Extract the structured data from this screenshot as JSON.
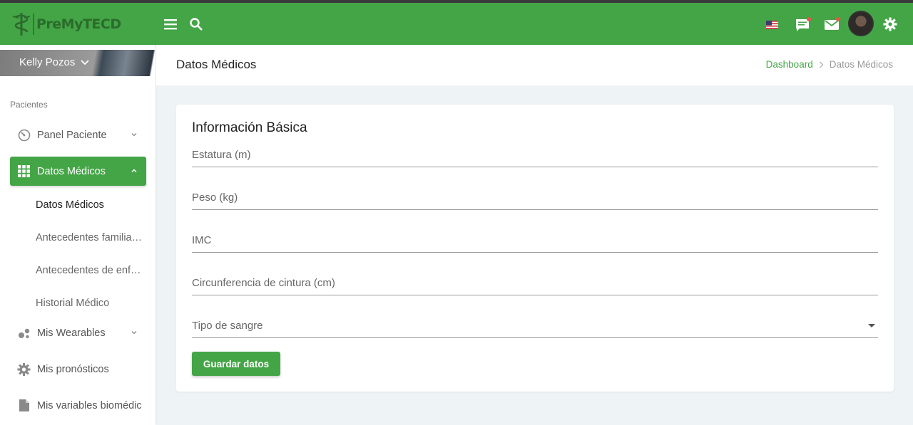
{
  "app": {
    "brand": "PreMyTECD",
    "accent_color": "#44a546"
  },
  "topbar": {
    "icons": [
      "menu-icon",
      "search-icon",
      "us-flag-icon",
      "chat-icon",
      "mail-icon",
      "avatar",
      "gear-icon"
    ]
  },
  "sidebar": {
    "user_name": "Kelly Pozos",
    "section_label": "Pacientes",
    "items": [
      {
        "label": "Panel Paciente",
        "icon": "dashboard-icon"
      },
      {
        "label": "Datos Médicos",
        "icon": "grid-icon"
      },
      {
        "label": "Mis Wearables",
        "icon": "bubbles-icon"
      },
      {
        "label": "Mis pronósticos",
        "icon": "gear-icon"
      },
      {
        "label": "Mis variables biomédic",
        "icon": "document-icon"
      }
    ],
    "subitems": [
      {
        "label": "Datos Médicos"
      },
      {
        "label": "Antecedentes familiares"
      },
      {
        "label": "Antecedentes de enfermedades"
      },
      {
        "label": "Historial Médico"
      }
    ]
  },
  "header": {
    "title": "Datos Médicos",
    "breadcrumb": [
      "Dashboard",
      "Datos Médicos"
    ]
  },
  "card": {
    "title": "Información Básica",
    "fields": [
      {
        "label": "Estatura (m)",
        "value": ""
      },
      {
        "label": "Peso (kg)",
        "value": ""
      },
      {
        "label": "IMC",
        "value": ""
      },
      {
        "label": "Circunferencia de cintura (cm)",
        "value": ""
      },
      {
        "label": "Tipo de sangre",
        "value": ""
      }
    ],
    "save_label": "Guardar datos"
  }
}
